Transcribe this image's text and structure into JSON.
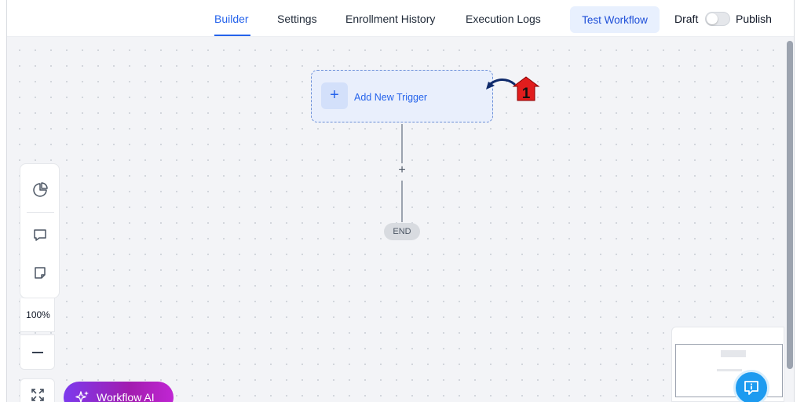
{
  "header": {
    "tabs": [
      {
        "label": "Builder",
        "active": true
      },
      {
        "label": "Settings",
        "active": false
      },
      {
        "label": "Enrollment History",
        "active": false
      },
      {
        "label": "Execution Logs",
        "active": false
      }
    ],
    "test_button": "Test Workflow",
    "draft_label": "Draft",
    "publish_label": "Publish",
    "publish_toggle_on": false
  },
  "canvas": {
    "trigger_label": "Add New Trigger",
    "add_step_symbol": "+",
    "end_label": "END",
    "annotation_number": "1"
  },
  "tools": {
    "zoom_level": "100%",
    "icons": [
      "pie-chart-icon",
      "comment-icon",
      "sticky-note-icon",
      "minus-icon",
      "fit-screen-icon"
    ]
  },
  "ai_button": {
    "label": "Workflow AI"
  },
  "colors": {
    "accent": "#2563eb",
    "ai_gradient_start": "#7c3aed",
    "ai_gradient_end": "#c026d3",
    "annotation_red": "#e11d1d",
    "chat_blue": "#1d9bf0"
  }
}
